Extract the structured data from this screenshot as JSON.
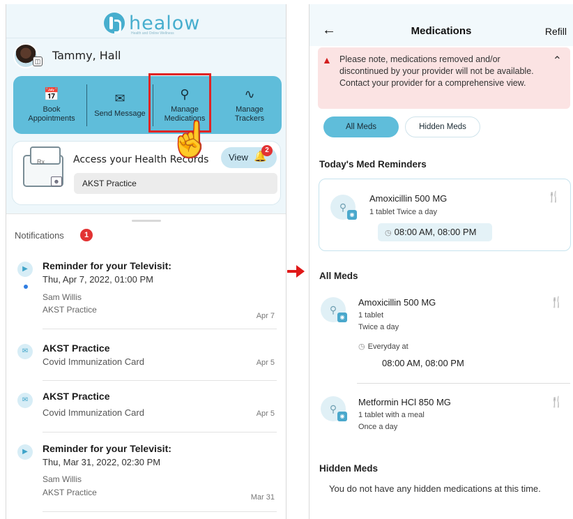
{
  "left": {
    "logo": "healow",
    "logo_sub": "Health and Online Wellness",
    "user_name": "Tammy, Hall",
    "actions": [
      {
        "label1": "Book",
        "label2": "Appointments",
        "icon": "calendar-icon"
      },
      {
        "label1": "Send Message",
        "label2": "",
        "icon": "mail-icon"
      },
      {
        "label1": "Manage",
        "label2": "Medications",
        "icon": "pill-icon"
      },
      {
        "label1": "Manage",
        "label2": "Trackers",
        "icon": "pulse-icon"
      }
    ],
    "health": {
      "access_text": "Access your Health Records",
      "rx_label": "Rx",
      "practice": "AKST Practice",
      "view": "View",
      "bell_count": "2"
    },
    "notifications_title": "Notifications",
    "notifications_count": "1",
    "notifications": [
      {
        "title": "Reminder for your Televisit:",
        "line": "Thu, Apr 7, 2022, 01:00 PM",
        "sub1": "Sam Willis",
        "sub2": "AKST Practice",
        "date": "Apr 7",
        "icon": "video-icon"
      },
      {
        "title": "AKST Practice",
        "line": "Covid Immunization Card",
        "date": "Apr 5",
        "icon": "mail-icon"
      },
      {
        "title": "AKST Practice",
        "line": "Covid Immunization Card",
        "date": "Apr 5",
        "icon": "mail-icon"
      },
      {
        "title": "Reminder for your Televisit:",
        "line": "Thu, Mar 31, 2022, 02:30 PM",
        "sub1": "Sam Willis",
        "sub2": "AKST Practice",
        "date": "Mar 31",
        "icon": "video-icon"
      }
    ]
  },
  "right": {
    "title": "Medications",
    "refill": "Refill",
    "alert": "Please note, medications removed and/or discontinued by your provider will not be available. Contact your provider for a comprehensive view.",
    "tabs": {
      "all": "All Meds",
      "hidden": "Hidden Meds"
    },
    "reminders_heading": "Today's Med Reminders",
    "reminder": {
      "name": "Amoxicillin 500 MG",
      "dose": "1 tablet Twice a day",
      "time": "08:00 AM, 08:00 PM"
    },
    "all_meds_heading": "All Meds",
    "meds": [
      {
        "name": "Amoxicillin 500 MG",
        "dose": "1 tablet",
        "freq": "Twice a day",
        "schedule": "Everyday at",
        "time": "08:00 AM, 08:00 PM"
      },
      {
        "name": "Metformin HCl 850 MG",
        "dose": "1 tablet with a meal",
        "freq": "Once a day"
      }
    ],
    "hidden_heading": "Hidden Meds",
    "hidden_text": "You do not have any hidden medications at this time."
  },
  "colors": {
    "accent": "#5fbdda",
    "highlight": "#e02424",
    "alert_bg": "#fbe3e3",
    "badge": "#e23333"
  }
}
